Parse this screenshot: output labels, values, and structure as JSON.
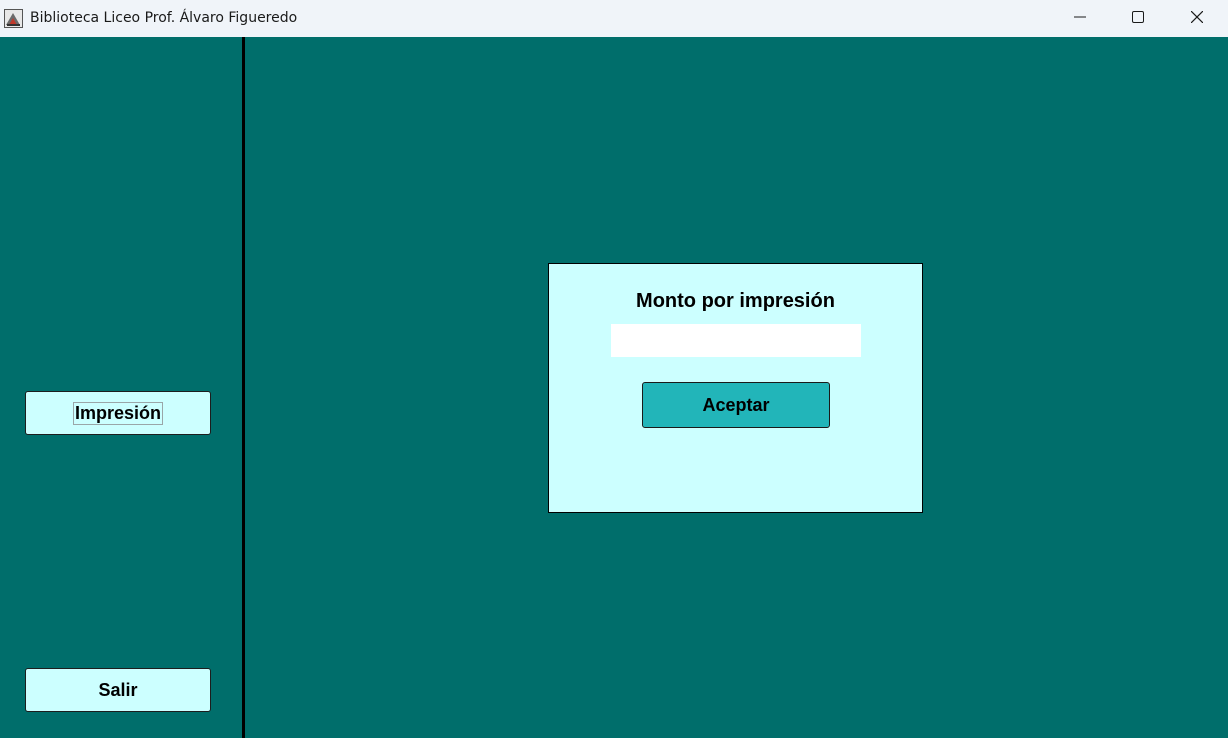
{
  "window": {
    "title": "Biblioteca Liceo Prof. Álvaro Figueredo",
    "icon": "app-logo-icon",
    "controls": [
      "minimize-icon",
      "maximize-icon",
      "close-icon"
    ]
  },
  "sidebar": {
    "buttons": [
      {
        "label": "Impresión"
      },
      {
        "label": "Salir"
      }
    ]
  },
  "dialog": {
    "title": "Monto por impresión",
    "amount_value": "",
    "accept_label": "Aceptar"
  },
  "colors": {
    "background": "#006e6b",
    "panel": "#ccffff",
    "accent_button": "#22b5b9",
    "titlebar": "#f0f4f9",
    "divider": "#000000"
  }
}
